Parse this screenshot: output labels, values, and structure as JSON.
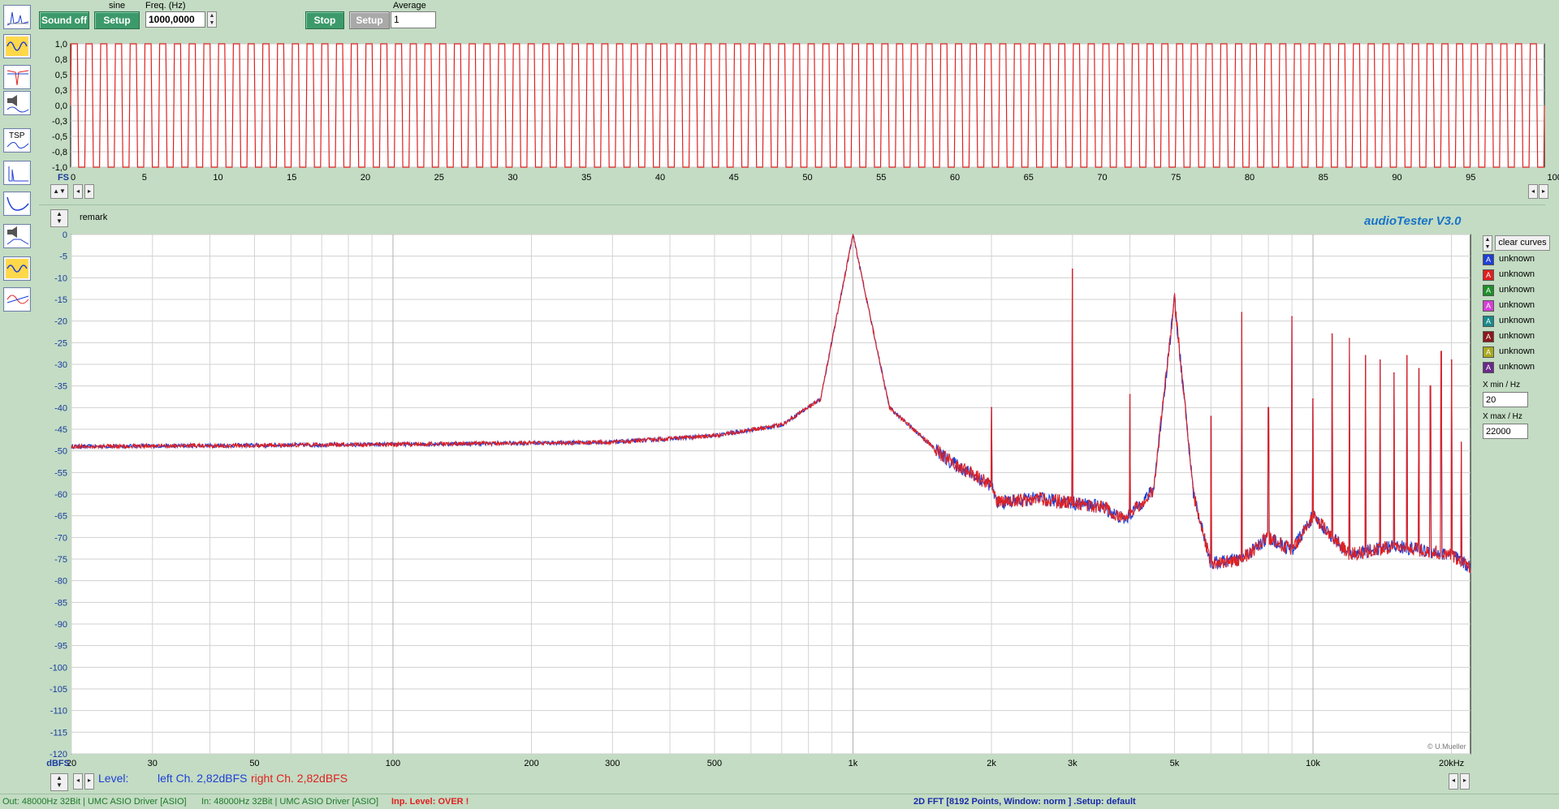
{
  "toolbar": {
    "sound_off_label": "Sound off",
    "signal_type_label": "sine",
    "setup_label": "Setup",
    "freq_label": "Freq. (Hz)",
    "freq_value": "1000,0000",
    "stop_label": "Stop",
    "setup2_label": "Setup",
    "average_label": "Average",
    "average_value": "1"
  },
  "sidebar": {
    "tools": [
      {
        "icon": "fft-spectrum-icon"
      },
      {
        "icon": "oscilloscope-icon"
      },
      {
        "icon": "filter-response-icon"
      },
      {
        "icon": "speaker-measure-icon"
      },
      {
        "icon": "tsp-icon",
        "label": "TSP"
      },
      {
        "icon": "impulse-response-icon"
      },
      {
        "icon": "frequency-curve-icon"
      },
      {
        "icon": "speaker-filter-icon"
      },
      {
        "icon": "oscilloscope-2-icon"
      },
      {
        "icon": "phase-response-icon"
      }
    ]
  },
  "scope": {
    "y_tick_labels": [
      "1,0",
      "0,8",
      "0,5",
      "0,3",
      "0,0",
      "-0,3",
      "-0,5",
      "-0,8",
      "-1,0"
    ],
    "x_unit_label": "FS",
    "x_tick_labels": [
      "0",
      "5",
      "10",
      "15",
      "20",
      "25",
      "30",
      "35",
      "40",
      "45",
      "50",
      "55",
      "60",
      "65",
      "70",
      "75",
      "80",
      "85",
      "90",
      "95",
      "100ms"
    ]
  },
  "spectrum": {
    "remark_label": "remark",
    "brand_label": "audioTester  V3.0",
    "watermark": "© U.Mueller",
    "y_unit_label": "dBFS",
    "y_tick_labels": [
      "0",
      "-5",
      "-10",
      "-15",
      "-20",
      "-25",
      "-30",
      "-35",
      "-40",
      "-45",
      "-50",
      "-55",
      "-60",
      "-65",
      "-70",
      "-75",
      "-80",
      "-85",
      "-90",
      "-95",
      "-100",
      "-105",
      "-110",
      "-115",
      "-120"
    ],
    "x_tick_labels": [
      "20",
      "30",
      "50",
      "100",
      "200",
      "300",
      "500",
      "1k",
      "2k",
      "3k",
      "5k",
      "10k",
      "20kHz"
    ],
    "level_label": "Level:",
    "left_level": "left Ch. 2,82dBFS",
    "right_level": "right Ch. 2,82dBFS"
  },
  "right_panel": {
    "clear_curves_label": "clear curves",
    "curves": [
      {
        "label": "unknown",
        "color": "#1f3fd6"
      },
      {
        "label": "unknown",
        "color": "#e02020"
      },
      {
        "label": "unknown",
        "color": "#1f8f2a"
      },
      {
        "label": "unknown",
        "color": "#d440d4"
      },
      {
        "label": "unknown",
        "color": "#1a8a8a"
      },
      {
        "label": "unknown",
        "color": "#8a1a1a"
      },
      {
        "label": "unknown",
        "color": "#a8a820"
      },
      {
        "label": "unknown",
        "color": "#6a2a8a"
      }
    ],
    "curve_marker": "A",
    "xmin_label": "X min / Hz",
    "xmin_value": "20",
    "xmax_label": "X max / Hz",
    "xmax_value": "22000"
  },
  "statusbar": {
    "out_info": "Out: 48000Hz 32Bit  | UMC ASIO Driver [ASIO]",
    "in_info": "In: 48000Hz 32Bit  | UMC ASIO Driver [ASIO]",
    "inp_level": "Inp. Level: OVER !",
    "fft_info": "2D FFT [8192 Points, Window: norm ] .Setup:  default"
  },
  "chart_data": [
    {
      "type": "line",
      "name": "time-domain scope",
      "title": "",
      "xlabel": "FS",
      "x_unit": "ms",
      "xlim": [
        0,
        100
      ],
      "ylim": [
        -1.0,
        1.0
      ],
      "signal": "clipped 1 kHz sine (square-like), 100 periods",
      "frequency_hz": 1000,
      "amplitude": 1.0,
      "grid": true
    },
    {
      "type": "line",
      "name": "FFT spectrum",
      "title": "",
      "xlabel": "",
      "ylabel": "dBFS",
      "x_scale": "log",
      "xlim": [
        20,
        22000
      ],
      "ylim": [
        -120,
        0
      ],
      "grid": true,
      "series": [
        {
          "name": "left Ch.",
          "color": "#1f3fd6"
        },
        {
          "name": "right Ch.",
          "color": "#e02020"
        }
      ],
      "noise_floor_db": [
        [
          20,
          -49
        ],
        [
          100,
          -48.5
        ],
        [
          300,
          -48
        ],
        [
          500,
          -46.5
        ],
        [
          700,
          -44
        ],
        [
          850,
          -38
        ],
        [
          1000,
          0
        ],
        [
          1200,
          -40
        ],
        [
          1600,
          -52
        ],
        [
          2000,
          -58
        ],
        [
          2050,
          -62
        ],
        [
          2500,
          -61
        ],
        [
          3000,
          -62
        ],
        [
          3500,
          -63
        ],
        [
          3900,
          -66
        ],
        [
          4500,
          -59
        ],
        [
          5000,
          -15
        ],
        [
          5500,
          -60
        ],
        [
          6000,
          -76
        ],
        [
          7000,
          -75
        ],
        [
          8000,
          -70
        ],
        [
          9000,
          -73
        ],
        [
          10000,
          -65
        ],
        [
          12000,
          -74
        ],
        [
          15000,
          -72
        ],
        [
          20000,
          -74
        ],
        [
          22000,
          -77
        ]
      ],
      "peaks": [
        {
          "x": 1000,
          "y": 0
        },
        {
          "x": 2000,
          "y": -40
        },
        {
          "x": 3000,
          "y": -8
        },
        {
          "x": 4000,
          "y": -37
        },
        {
          "x": 5000,
          "y": -14
        },
        {
          "x": 6000,
          "y": -42
        },
        {
          "x": 7000,
          "y": -18
        },
        {
          "x": 8000,
          "y": -40
        },
        {
          "x": 9000,
          "y": -19
        },
        {
          "x": 10000,
          "y": -38
        },
        {
          "x": 11000,
          "y": -23
        },
        {
          "x": 12000,
          "y": -24
        },
        {
          "x": 13000,
          "y": -28
        },
        {
          "x": 14000,
          "y": -29
        },
        {
          "x": 15000,
          "y": -32
        },
        {
          "x": 16000,
          "y": -28
        },
        {
          "x": 17000,
          "y": -31
        },
        {
          "x": 18000,
          "y": -35
        },
        {
          "x": 19000,
          "y": -27
        },
        {
          "x": 20000,
          "y": -29
        },
        {
          "x": 21000,
          "y": -48
        }
      ]
    }
  ]
}
